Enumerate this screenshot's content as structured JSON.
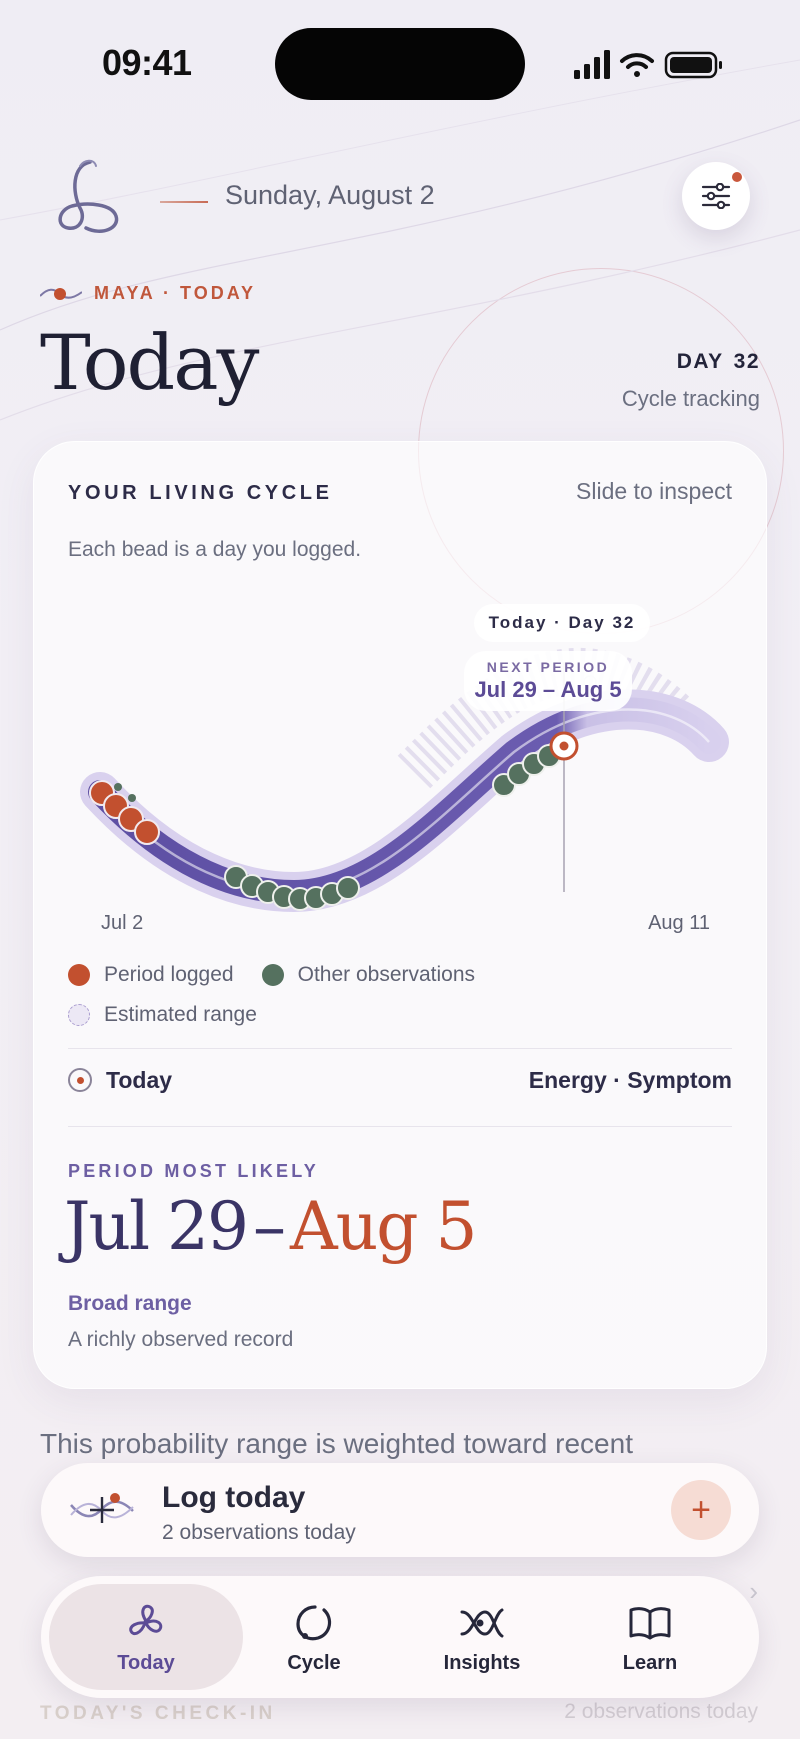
{
  "status_bar": {
    "time": "09:41"
  },
  "header": {
    "date": "Sunday, August 2"
  },
  "eyebrow": "MAYA · TODAY",
  "page_title": "Today",
  "day": {
    "label": "DAY",
    "number": "32",
    "subtitle": "Cycle tracking"
  },
  "card": {
    "heading": "YOUR LIVING CYCLE",
    "hint": "Slide to inspect",
    "subtitle": "Each bead is a day you logged.",
    "tooltip_today": "Today · Day 32",
    "tooltip_next_label": "NEXT PERIOD",
    "tooltip_next_value": "Jul 29 – Aug 5",
    "axis_start": "Jul 2",
    "axis_end": "Aug 11",
    "legend": {
      "period": "Period logged",
      "other": "Other observations",
      "estimated": "Estimated range"
    },
    "today_label": "Today",
    "today_detail": "Energy · Symptom",
    "likely_label": "PERIOD MOST LIKELY",
    "likely_from": "Jul 29",
    "likely_sep": "–",
    "likely_to": "Aug 5",
    "broad": "Broad range",
    "record": "A richly observed record"
  },
  "probability_text": "This probability range is weighted toward recent",
  "log_bar": {
    "title": "Log today",
    "subtitle": "2 observations today",
    "add": "+"
  },
  "tabs": [
    {
      "label": "Today",
      "icon": "flower-icon",
      "active": true
    },
    {
      "label": "Cycle",
      "icon": "cycle-icon",
      "active": false
    },
    {
      "label": "Insights",
      "icon": "insights-icon",
      "active": false
    },
    {
      "label": "Learn",
      "icon": "book-icon",
      "active": false
    }
  ],
  "checkin": {
    "label": "TODAY'S CHECK-IN",
    "count": "2 observations today"
  },
  "colors": {
    "period": "#c2502f",
    "observation": "#55715f",
    "accent": "#5c4b96",
    "estimated": "#ece8f5"
  }
}
